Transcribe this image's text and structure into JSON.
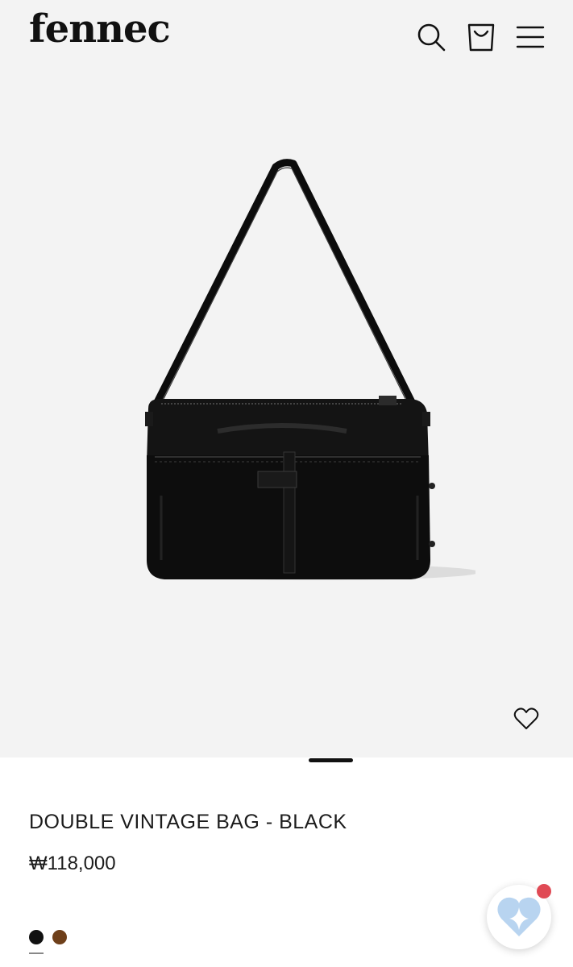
{
  "header": {
    "logo": "fennec",
    "icons": [
      "search-icon",
      "shopping-bag-icon",
      "menu-icon"
    ]
  },
  "product": {
    "title": "DOUBLE VINTAGE BAG - BLACK",
    "price": "₩118,000",
    "image_alt": "black leather shoulder bag",
    "colors": [
      {
        "name": "black",
        "hex": "#111111",
        "selected": true
      },
      {
        "name": "brown",
        "hex": "#6e3f1a",
        "selected": false
      }
    ],
    "gallery_index": 1
  },
  "colors": {
    "background": "#f3f3f3",
    "text": "#1c1c1c",
    "notification": "#e04a55"
  }
}
